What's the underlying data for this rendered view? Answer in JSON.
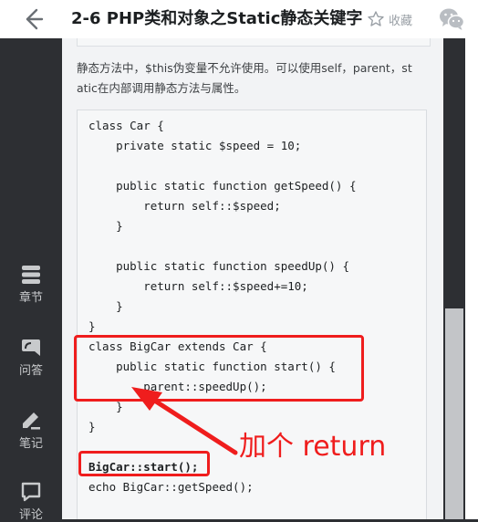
{
  "header": {
    "title": "2-6 PHP类和对象之Static静态关键字",
    "favorite_label": "收藏"
  },
  "sidebar": {
    "items": [
      {
        "label": "章节"
      },
      {
        "label": "问答"
      },
      {
        "label": "笔记"
      },
      {
        "label": "评论"
      }
    ]
  },
  "content": {
    "description_line1": "静态方法中，$this伪变量不允许使用。可以使用self，parent，st",
    "description_line2": "atic在内部调用静态方法与属性。",
    "code_lines": [
      "class Car {",
      "    private static $speed = 10;",
      "",
      "    public static function getSpeed() {",
      "        return self::$speed;",
      "    }",
      "",
      "    public static function speedUp() {",
      "        return self::$speed+=10;",
      "    }",
      "}",
      "class BigCar extends Car {",
      "    public static function start() {",
      "        parent::speedUp();",
      "    }",
      "}",
      "",
      "BigCar::start();",
      "echo BigCar::getSpeed();"
    ]
  },
  "annotation": {
    "text": "加个 return",
    "color": "#ef1d1d"
  },
  "colors": {
    "sidebar_bg": "#2d2f33",
    "content_bg": "#f2f3f5",
    "code_bg": "#f6f7f8"
  }
}
